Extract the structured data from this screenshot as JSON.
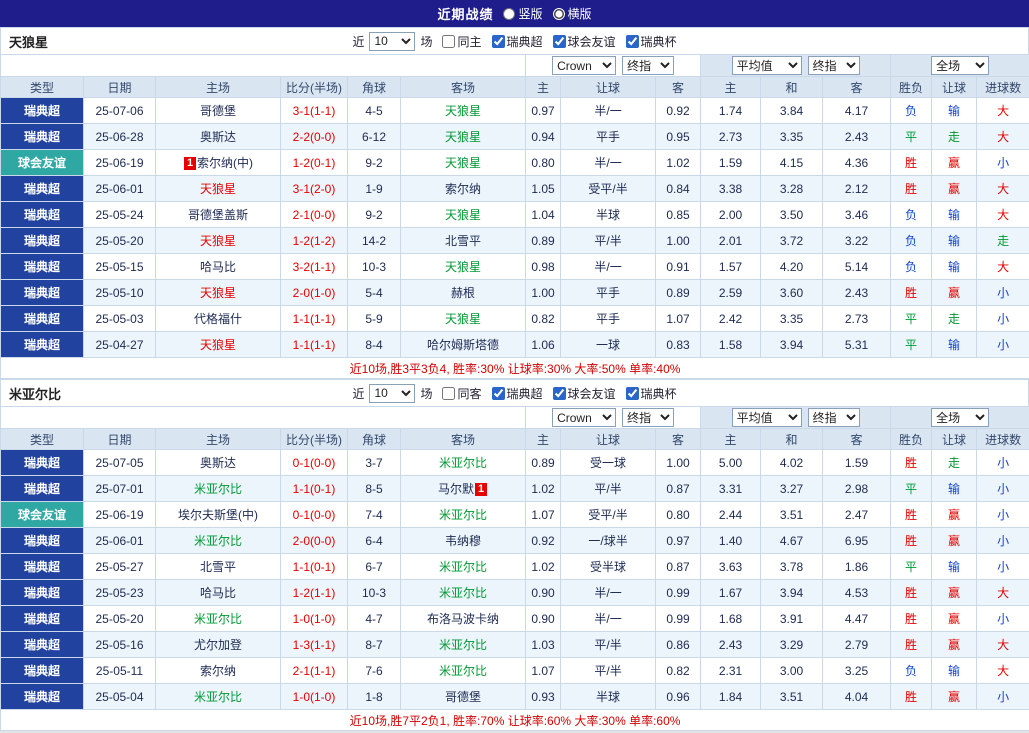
{
  "titlebar": {
    "title": "近期战绩",
    "options": [
      {
        "label": "竖版",
        "checked": false
      },
      {
        "label": "横版",
        "checked": true
      }
    ]
  },
  "palette": {
    "titlebar_bg": "#1f1d8c",
    "league_badge": "#2242a0",
    "friendly_badge": "#2fa8a3",
    "header_bg": "#d9e6f2",
    "stripe_bg": "#edf5fc",
    "win_red": "#e60000",
    "draw_green": "#009933",
    "lose_blue": "#1144cc",
    "summary_red": "#d40000"
  },
  "columns": [
    "类型",
    "日期",
    "主场",
    "比分(半场)",
    "角球",
    "客场",
    "主",
    "让球",
    "客",
    "主",
    "和",
    "客",
    "胜负",
    "让球",
    "进球数"
  ],
  "controls": {
    "bookmaker": "Crown",
    "bookmaker_stage": "终指",
    "average": "平均值",
    "average_stage": "终指",
    "fulltime": "全场"
  },
  "sections": [
    {
      "team": "天狼星",
      "filter": {
        "near_label": "近",
        "count": "10",
        "matches_label": "场",
        "checkboxes": [
          {
            "label": "同主",
            "checked": false
          },
          {
            "label": "瑞典超",
            "checked": true
          },
          {
            "label": "球会友谊",
            "checked": true
          },
          {
            "label": "瑞典杯",
            "checked": true
          }
        ]
      },
      "rows": [
        {
          "type": "瑞典超",
          "league": "league",
          "date": "25-07-06",
          "home": {
            "t": "哥德堡",
            "c": "dark"
          },
          "score": "3-1(1-1)",
          "corners": "4-5",
          "away": {
            "t": "天狼星",
            "c": "green"
          },
          "odds": [
            "0.97",
            "半/一",
            "0.92"
          ],
          "avg": [
            "1.74",
            "3.84",
            "4.17"
          ],
          "results": [
            [
              "负",
              "lose"
            ],
            [
              "输",
              "lose"
            ],
            [
              "大",
              "win"
            ]
          ]
        },
        {
          "type": "瑞典超",
          "league": "league",
          "date": "25-06-28",
          "home": {
            "t": "奥斯达",
            "c": "dark"
          },
          "score": "2-2(0-0)",
          "corners": "6-12",
          "away": {
            "t": "天狼星",
            "c": "green"
          },
          "odds": [
            "0.94",
            "平手",
            "0.95"
          ],
          "avg": [
            "2.73",
            "3.35",
            "2.43"
          ],
          "results": [
            [
              "平",
              "draw"
            ],
            [
              "走",
              "draw"
            ],
            [
              "大",
              "win"
            ]
          ]
        },
        {
          "type": "球会友谊",
          "league": "friendly",
          "date": "25-06-19",
          "home": {
            "t": "索尔纳(中)",
            "c": "dark",
            "b": "1",
            "bp": "before"
          },
          "score": "1-2(0-1)",
          "corners": "9-2",
          "away": {
            "t": "天狼星",
            "c": "green"
          },
          "odds": [
            "0.80",
            "半/一",
            "1.02"
          ],
          "avg": [
            "1.59",
            "4.15",
            "4.36"
          ],
          "results": [
            [
              "胜",
              "win"
            ],
            [
              "赢",
              "win"
            ],
            [
              "小",
              "lose"
            ]
          ]
        },
        {
          "type": "瑞典超",
          "league": "league",
          "date": "25-06-01",
          "home": {
            "t": "天狼星",
            "c": "red"
          },
          "score": "3-1(2-0)",
          "corners": "1-9",
          "away": {
            "t": "索尔纳",
            "c": "dark"
          },
          "odds": [
            "1.05",
            "受平/半",
            "0.84"
          ],
          "avg": [
            "3.38",
            "3.28",
            "2.12"
          ],
          "results": [
            [
              "胜",
              "win"
            ],
            [
              "赢",
              "win"
            ],
            [
              "大",
              "win"
            ]
          ]
        },
        {
          "type": "瑞典超",
          "league": "league",
          "date": "25-05-24",
          "home": {
            "t": "哥德堡盖斯",
            "c": "dark"
          },
          "score": "2-1(0-0)",
          "corners": "9-2",
          "away": {
            "t": "天狼星",
            "c": "green"
          },
          "odds": [
            "1.04",
            "半球",
            "0.85"
          ],
          "avg": [
            "2.00",
            "3.50",
            "3.46"
          ],
          "results": [
            [
              "负",
              "lose"
            ],
            [
              "输",
              "lose"
            ],
            [
              "大",
              "win"
            ]
          ]
        },
        {
          "type": "瑞典超",
          "league": "league",
          "date": "25-05-20",
          "home": {
            "t": "天狼星",
            "c": "red"
          },
          "score": "1-2(1-2)",
          "corners": "14-2",
          "away": {
            "t": "北雪平",
            "c": "dark"
          },
          "odds": [
            "0.89",
            "平/半",
            "1.00"
          ],
          "avg": [
            "2.01",
            "3.72",
            "3.22"
          ],
          "results": [
            [
              "负",
              "lose"
            ],
            [
              "输",
              "lose"
            ],
            [
              "走",
              "draw"
            ]
          ]
        },
        {
          "type": "瑞典超",
          "league": "league",
          "date": "25-05-15",
          "home": {
            "t": "哈马比",
            "c": "dark"
          },
          "score": "3-2(1-1)",
          "corners": "10-3",
          "away": {
            "t": "天狼星",
            "c": "green"
          },
          "odds": [
            "0.98",
            "半/一",
            "0.91"
          ],
          "avg": [
            "1.57",
            "4.20",
            "5.14"
          ],
          "results": [
            [
              "负",
              "lose"
            ],
            [
              "输",
              "lose"
            ],
            [
              "大",
              "win"
            ]
          ]
        },
        {
          "type": "瑞典超",
          "league": "league",
          "date": "25-05-10",
          "home": {
            "t": "天狼星",
            "c": "red"
          },
          "score": "2-0(1-0)",
          "corners": "5-4",
          "away": {
            "t": "赫根",
            "c": "dark"
          },
          "odds": [
            "1.00",
            "平手",
            "0.89"
          ],
          "avg": [
            "2.59",
            "3.60",
            "2.43"
          ],
          "results": [
            [
              "胜",
              "win"
            ],
            [
              "赢",
              "win"
            ],
            [
              "小",
              "lose"
            ]
          ]
        },
        {
          "type": "瑞典超",
          "league": "league",
          "date": "25-05-03",
          "home": {
            "t": "代格福什",
            "c": "dark"
          },
          "score": "1-1(1-1)",
          "corners": "5-9",
          "away": {
            "t": "天狼星",
            "c": "green"
          },
          "odds": [
            "0.82",
            "平手",
            "1.07"
          ],
          "avg": [
            "2.42",
            "3.35",
            "2.73"
          ],
          "results": [
            [
              "平",
              "draw"
            ],
            [
              "走",
              "draw"
            ],
            [
              "小",
              "lose"
            ]
          ]
        },
        {
          "type": "瑞典超",
          "league": "league",
          "date": "25-04-27",
          "home": {
            "t": "天狼星",
            "c": "red"
          },
          "score": "1-1(1-1)",
          "corners": "8-4",
          "away": {
            "t": "哈尔姆斯塔德",
            "c": "dark"
          },
          "odds": [
            "1.06",
            "一球",
            "0.83"
          ],
          "avg": [
            "1.58",
            "3.94",
            "5.31"
          ],
          "results": [
            [
              "平",
              "draw"
            ],
            [
              "输",
              "lose"
            ],
            [
              "小",
              "lose"
            ]
          ]
        }
      ],
      "summary": "近10场,胜3平3负4, 胜率:30% 让球率:30% 大率:50% 单率:40%"
    },
    {
      "team": "米亚尔比",
      "filter": {
        "near_label": "近",
        "count": "10",
        "matches_label": "场",
        "checkboxes": [
          {
            "label": "同客",
            "checked": false
          },
          {
            "label": "瑞典超",
            "checked": true
          },
          {
            "label": "球会友谊",
            "checked": true
          },
          {
            "label": "瑞典杯",
            "checked": true
          }
        ]
      },
      "rows": [
        {
          "type": "瑞典超",
          "league": "league",
          "date": "25-07-05",
          "home": {
            "t": "奥斯达",
            "c": "dark"
          },
          "score": "0-1(0-0)",
          "corners": "3-7",
          "away": {
            "t": "米亚尔比",
            "c": "green"
          },
          "odds": [
            "0.89",
            "受一球",
            "1.00"
          ],
          "avg": [
            "5.00",
            "4.02",
            "1.59"
          ],
          "results": [
            [
              "胜",
              "win"
            ],
            [
              "走",
              "draw"
            ],
            [
              "小",
              "lose"
            ]
          ]
        },
        {
          "type": "瑞典超",
          "league": "league",
          "date": "25-07-01",
          "home": {
            "t": "米亚尔比",
            "c": "green"
          },
          "score": "1-1(0-1)",
          "corners": "8-5",
          "away": {
            "t": "马尔默",
            "c": "dark",
            "b": "1",
            "bp": "after"
          },
          "odds": [
            "1.02",
            "平/半",
            "0.87"
          ],
          "avg": [
            "3.31",
            "3.27",
            "2.98"
          ],
          "results": [
            [
              "平",
              "draw"
            ],
            [
              "输",
              "lose"
            ],
            [
              "小",
              "lose"
            ]
          ]
        },
        {
          "type": "球会友谊",
          "league": "friendly",
          "date": "25-06-19",
          "home": {
            "t": "埃尔夫斯堡(中)",
            "c": "dark"
          },
          "score": "0-1(0-0)",
          "corners": "7-4",
          "away": {
            "t": "米亚尔比",
            "c": "green"
          },
          "odds": [
            "1.07",
            "受平/半",
            "0.80"
          ],
          "avg": [
            "2.44",
            "3.51",
            "2.47"
          ],
          "results": [
            [
              "胜",
              "win"
            ],
            [
              "赢",
              "win"
            ],
            [
              "小",
              "lose"
            ]
          ]
        },
        {
          "type": "瑞典超",
          "league": "league",
          "date": "25-06-01",
          "home": {
            "t": "米亚尔比",
            "c": "green"
          },
          "score": "2-0(0-0)",
          "corners": "6-4",
          "away": {
            "t": "韦纳穆",
            "c": "dark"
          },
          "odds": [
            "0.92",
            "一/球半",
            "0.97"
          ],
          "avg": [
            "1.40",
            "4.67",
            "6.95"
          ],
          "results": [
            [
              "胜",
              "win"
            ],
            [
              "赢",
              "win"
            ],
            [
              "小",
              "lose"
            ]
          ]
        },
        {
          "type": "瑞典超",
          "league": "league",
          "date": "25-05-27",
          "home": {
            "t": "北雪平",
            "c": "dark"
          },
          "score": "1-1(0-1)",
          "corners": "6-7",
          "away": {
            "t": "米亚尔比",
            "c": "green"
          },
          "odds": [
            "1.02",
            "受半球",
            "0.87"
          ],
          "avg": [
            "3.63",
            "3.78",
            "1.86"
          ],
          "results": [
            [
              "平",
              "draw"
            ],
            [
              "输",
              "lose"
            ],
            [
              "小",
              "lose"
            ]
          ]
        },
        {
          "type": "瑞典超",
          "league": "league",
          "date": "25-05-23",
          "home": {
            "t": "哈马比",
            "c": "dark"
          },
          "score": "1-2(1-1)",
          "corners": "10-3",
          "away": {
            "t": "米亚尔比",
            "c": "green"
          },
          "odds": [
            "0.90",
            "半/一",
            "0.99"
          ],
          "avg": [
            "1.67",
            "3.94",
            "4.53"
          ],
          "results": [
            [
              "胜",
              "win"
            ],
            [
              "赢",
              "win"
            ],
            [
              "大",
              "win"
            ]
          ]
        },
        {
          "type": "瑞典超",
          "league": "league",
          "date": "25-05-20",
          "home": {
            "t": "米亚尔比",
            "c": "green"
          },
          "score": "1-0(1-0)",
          "corners": "4-7",
          "away": {
            "t": "布洛马波卡纳",
            "c": "dark"
          },
          "odds": [
            "0.90",
            "半/一",
            "0.99"
          ],
          "avg": [
            "1.68",
            "3.91",
            "4.47"
          ],
          "results": [
            [
              "胜",
              "win"
            ],
            [
              "赢",
              "win"
            ],
            [
              "小",
              "lose"
            ]
          ]
        },
        {
          "type": "瑞典超",
          "league": "league",
          "date": "25-05-16",
          "home": {
            "t": "尤尔加登",
            "c": "dark"
          },
          "score": "1-3(1-1)",
          "corners": "8-7",
          "away": {
            "t": "米亚尔比",
            "c": "green"
          },
          "odds": [
            "1.03",
            "平/半",
            "0.86"
          ],
          "avg": [
            "2.43",
            "3.29",
            "2.79"
          ],
          "results": [
            [
              "胜",
              "win"
            ],
            [
              "赢",
              "win"
            ],
            [
              "大",
              "win"
            ]
          ]
        },
        {
          "type": "瑞典超",
          "league": "league",
          "date": "25-05-11",
          "home": {
            "t": "索尔纳",
            "c": "dark"
          },
          "score": "2-1(1-1)",
          "corners": "7-6",
          "away": {
            "t": "米亚尔比",
            "c": "green"
          },
          "odds": [
            "1.07",
            "平/半",
            "0.82"
          ],
          "avg": [
            "2.31",
            "3.00",
            "3.25"
          ],
          "results": [
            [
              "负",
              "lose"
            ],
            [
              "输",
              "lose"
            ],
            [
              "大",
              "win"
            ]
          ]
        },
        {
          "type": "瑞典超",
          "league": "league",
          "date": "25-05-04",
          "home": {
            "t": "米亚尔比",
            "c": "green"
          },
          "score": "1-0(1-0)",
          "corners": "1-8",
          "away": {
            "t": "哥德堡",
            "c": "dark"
          },
          "odds": [
            "0.93",
            "半球",
            "0.96"
          ],
          "avg": [
            "1.84",
            "3.51",
            "4.04"
          ],
          "results": [
            [
              "胜",
              "win"
            ],
            [
              "赢",
              "win"
            ],
            [
              "小",
              "lose"
            ]
          ]
        }
      ],
      "summary": "近10场,胜7平2负1, 胜率:70% 让球率:60% 大率:30% 单率:60%"
    }
  ]
}
